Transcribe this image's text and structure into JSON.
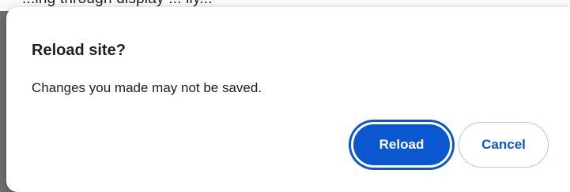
{
  "background": {
    "partial_text": "...ing through display ... lly..."
  },
  "dialog": {
    "title": "Reload site?",
    "message": "Changes you made may not be saved.",
    "buttons": {
      "reload_label": "Reload",
      "cancel_label": "Cancel"
    }
  },
  "colors": {
    "primary": "#0b57d0",
    "primary_text": "#ffffff",
    "scrim": "#6b6d70"
  }
}
